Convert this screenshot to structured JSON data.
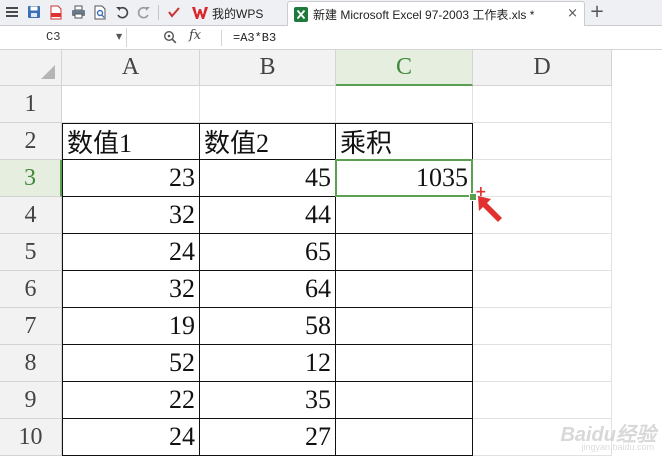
{
  "tabs": {
    "wps_label": "我的WPS",
    "file_label": "新建 Microsoft Excel 97-2003 工作表.xls *",
    "close_glyph": "×",
    "new_tab_glyph": "+"
  },
  "formula_bar": {
    "cell_ref": "C3",
    "fx_label": "fx",
    "formula": "=A3*B3"
  },
  "grid": {
    "columns": [
      "A",
      "B",
      "C",
      "D"
    ],
    "rows": [
      "1",
      "2",
      "3",
      "4",
      "5",
      "6",
      "7",
      "8",
      "9",
      "10"
    ],
    "headers": [
      "数值1",
      "数值2",
      "乘积"
    ],
    "data": [
      [
        "23",
        "45",
        "1035"
      ],
      [
        "32",
        "44",
        ""
      ],
      [
        "24",
        "65",
        ""
      ],
      [
        "32",
        "64",
        ""
      ],
      [
        "19",
        "58",
        ""
      ],
      [
        "52",
        "12",
        ""
      ],
      [
        "22",
        "35",
        ""
      ],
      [
        "24",
        "27",
        ""
      ]
    ],
    "active_column": "C",
    "active_row": "3"
  },
  "watermark": {
    "text": "Baidu经验",
    "sub": "jingyan.baidu.com"
  },
  "colors": {
    "selection": "#5aa050",
    "wps_red": "#d9262c",
    "excel_green": "#1e7a3c",
    "cursor_red": "#e03030"
  },
  "icons": [
    "app-menu-icon",
    "save-icon",
    "export-pdf-icon",
    "print-icon",
    "print-preview-icon",
    "undo-icon",
    "redo-icon",
    "customize-toolbar-icon",
    "wps-logo-icon",
    "excel-file-icon",
    "zoom-icon"
  ]
}
